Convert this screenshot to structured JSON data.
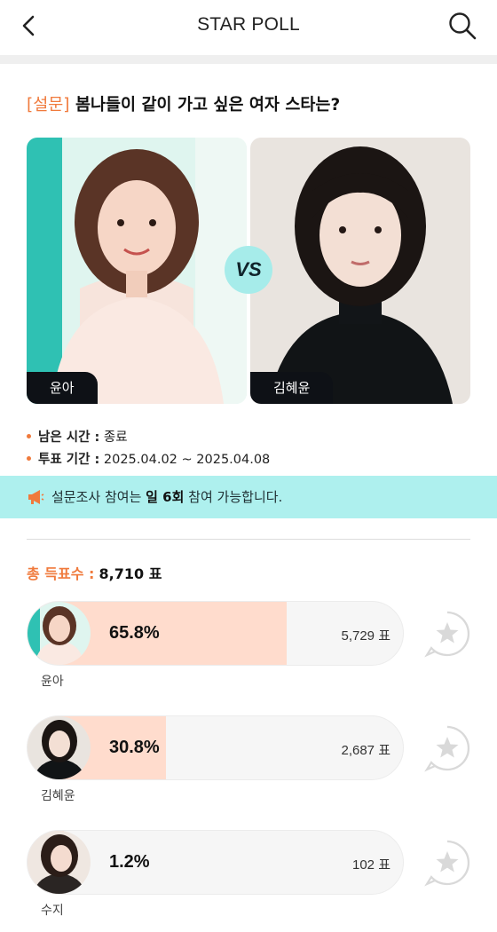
{
  "header": {
    "title": "STAR POLL",
    "back_icon": "chevron-left-icon",
    "search_icon": "search-icon"
  },
  "poll": {
    "tag": "[설문]",
    "question": "봄나들이 같이 가고 싶은 여자 스타는?",
    "vs_label": "VS",
    "candidates": [
      {
        "name": "윤아"
      },
      {
        "name": "김혜윤"
      }
    ]
  },
  "info": {
    "remaining_label": "남은 시간 :",
    "remaining_value": "종료",
    "period_label": "투표 기간 :",
    "period_value": "2025.04.02 ~ 2025.04.08"
  },
  "notice": {
    "icon": "megaphone-icon",
    "text_before": "설문조사 참여는 ",
    "text_bold": "일 6회",
    "text_after": " 참여 가능합니다."
  },
  "total": {
    "label": "총 득표수 :",
    "value": "8,710 표"
  },
  "results": [
    {
      "name": "윤아",
      "percent_text": "65.8%",
      "percent": 65.8,
      "votes": "5,729 표"
    },
    {
      "name": "김혜윤",
      "percent_text": "30.8%",
      "percent": 30.8,
      "votes": "2,687 표"
    },
    {
      "name": "수지",
      "percent_text": "1.2%",
      "percent": 1.2,
      "votes": "102 표"
    }
  ],
  "colors": {
    "accent": "#f07a3c",
    "notice_bg": "#aef0ee",
    "bar_fill": "#ffdccd",
    "vs_bg": "#a6ecea"
  }
}
